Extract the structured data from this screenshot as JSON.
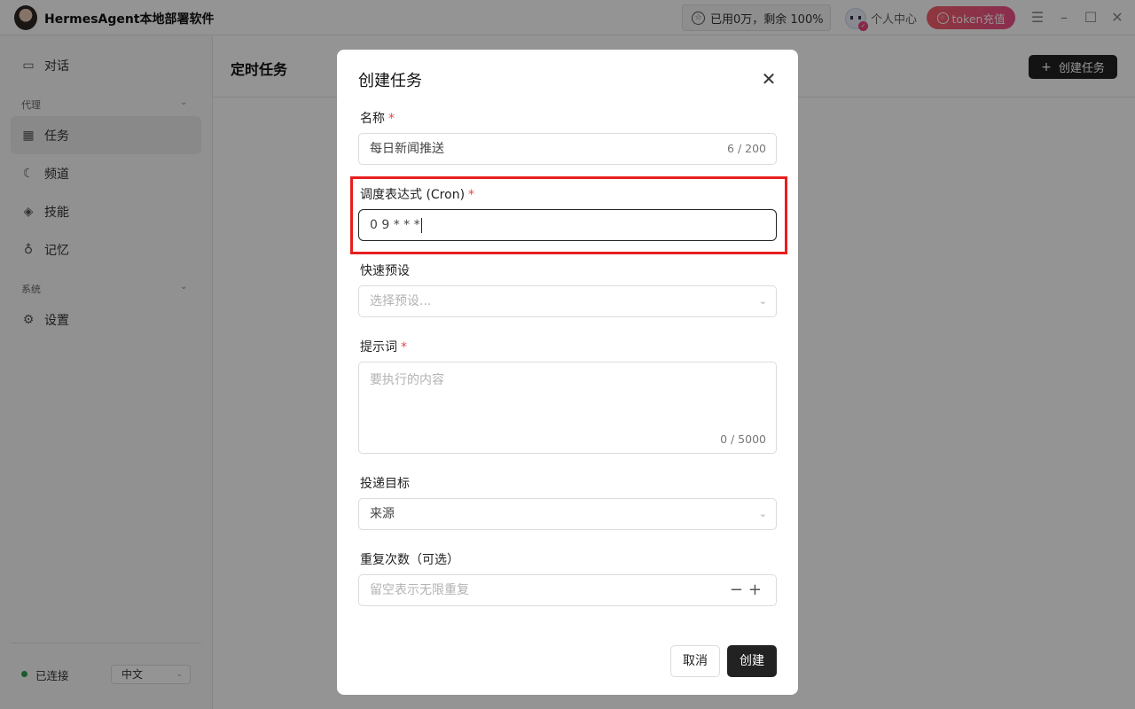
{
  "app": {
    "title": "HermesAgent本地部署软件",
    "quota_text": "已用0万，剩余 100%",
    "user_center": "个人中心",
    "recharge_label": "token充值"
  },
  "sidebar": {
    "items_top": [
      {
        "label": "对话",
        "icon": "chat-bubble-icon"
      }
    ],
    "section_agent": "代理",
    "items_agent": [
      {
        "label": "任务",
        "icon": "calendar-icon",
        "active": true
      },
      {
        "label": "频道",
        "icon": "moon-icon"
      },
      {
        "label": "技能",
        "icon": "layers-icon"
      },
      {
        "label": "记忆",
        "icon": "lightbulb-icon"
      }
    ],
    "section_system": "系统",
    "items_system": [
      {
        "label": "设置",
        "icon": "gear-icon"
      }
    ],
    "status": "已连接",
    "language": "中文"
  },
  "main": {
    "page_title": "定时任务",
    "create_button": "创建任务"
  },
  "modal": {
    "title": "创建任务",
    "name": {
      "label": "名称",
      "value": "每日新闻推送",
      "counter": "6 / 200"
    },
    "cron": {
      "label": "调度表达式 (Cron)",
      "value": "0 9 * * *"
    },
    "preset": {
      "label": "快速预设",
      "placeholder": "选择预设..."
    },
    "prompt": {
      "label": "提示词",
      "placeholder": "要执行的内容",
      "counter": "0 / 5000"
    },
    "delivery": {
      "label": "投递目标",
      "value": "来源"
    },
    "repeat": {
      "label": "重复次数（可选）",
      "placeholder": "留空表示无限重复"
    },
    "cancel_label": "取消",
    "create_label": "创建"
  },
  "colors": {
    "accent": "#222222",
    "required": "#e5484d",
    "highlight": "#e81e1e",
    "recharge": "#f05a78",
    "status_ok": "#2f9b4b"
  }
}
